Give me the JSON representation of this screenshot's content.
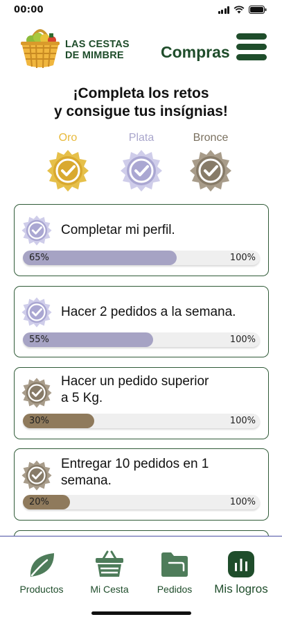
{
  "status_bar": {
    "time": "00:00"
  },
  "header": {
    "brand_line1": "LAS CESTAS",
    "brand_line2": "DE MIMBRE",
    "section_title": "Compras"
  },
  "heading": {
    "line1": "¡Completa los retos",
    "line2": "y consigue tus insígnias!"
  },
  "medals": [
    {
      "label": "Oro",
      "color": "#e0b63c",
      "label_color": "#e8b93a"
    },
    {
      "label": "Plata",
      "color": "#b8b6dc",
      "label_color": "#a9a6cc"
    },
    {
      "label": "Bronce",
      "color": "#8f8372",
      "label_color": "#7a705f"
    }
  ],
  "challenges": [
    {
      "title_line1": "Completar mi perfil.",
      "title_line2": "",
      "progress": 0.65,
      "progress_label": "65%",
      "max_label": "100%",
      "medal": "silver",
      "fill_color": "#a6a3c4"
    },
    {
      "title_line1": "Hacer 2 pedidos a la semana.",
      "title_line2": "",
      "progress": 0.55,
      "progress_label": "55%",
      "max_label": "100%",
      "medal": "silver",
      "fill_color": "#a6a3c4"
    },
    {
      "title_line1": "Hacer un pedido superior",
      "title_line2": "a 5 Kg.",
      "progress": 0.3,
      "progress_label": "30%",
      "max_label": "100%",
      "medal": "bronze",
      "fill_color": "#8f7a5c"
    },
    {
      "title_line1": "Entregar 10 pedidos en 1",
      "title_line2": "semana.",
      "progress": 0.2,
      "progress_label": "20%",
      "max_label": "100%",
      "medal": "bronze",
      "fill_color": "#8f7a5c"
    }
  ],
  "nav": {
    "items": [
      {
        "label": "Productos",
        "icon": "leaf-icon"
      },
      {
        "label": "Mi Cesta",
        "icon": "basket-icon"
      },
      {
        "label": "Pedidos",
        "icon": "folder-icon"
      },
      {
        "label": "Mis logros",
        "icon": "chart-icon",
        "active": true
      }
    ]
  },
  "colors": {
    "brand_green": "#1f4d2b",
    "icon_green": "#4e7c5a"
  }
}
